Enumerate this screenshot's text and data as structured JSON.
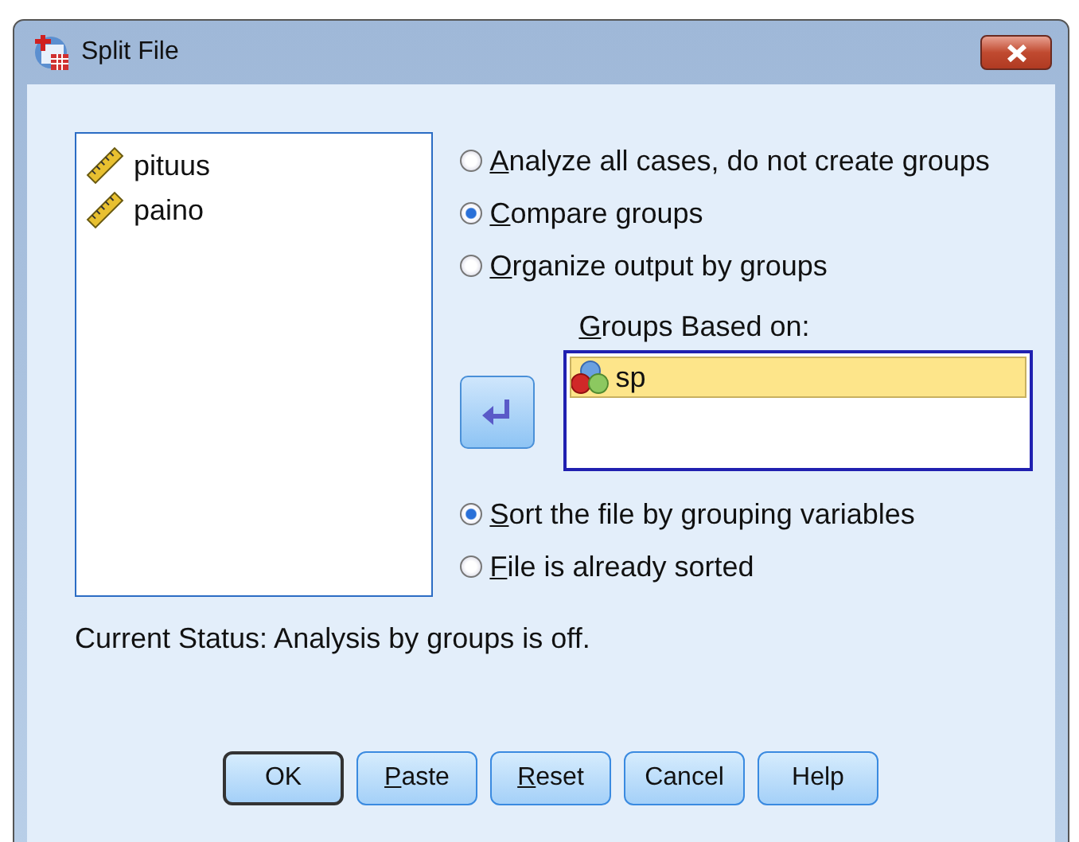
{
  "window": {
    "title": "Split File"
  },
  "variables": [
    {
      "name": "pituus"
    },
    {
      "name": "paino"
    }
  ],
  "grouping_options": [
    {
      "label": "Analyze all cases, do not create groups",
      "selected": false,
      "underline_first": true
    },
    {
      "label": "Compare groups",
      "selected": true,
      "underline_first": true
    },
    {
      "label": "Organize output by groups",
      "selected": false,
      "underline_first": true
    }
  ],
  "groups_based_on": {
    "label": "Groups Based on:",
    "underline_first": true,
    "items": [
      {
        "name": "sp",
        "selected": true
      }
    ]
  },
  "sort_options": [
    {
      "label": "Sort the file by grouping variables",
      "selected": true,
      "underline_first": true
    },
    {
      "label": "File is already sorted",
      "selected": false,
      "underline_first": true
    }
  ],
  "status": "Current Status: Analysis by groups is off.",
  "buttons": [
    {
      "label": "OK",
      "default": true,
      "underline_first": false
    },
    {
      "label": "Paste",
      "default": false,
      "underline_first": true
    },
    {
      "label": "Reset",
      "default": false,
      "underline_first": true
    },
    {
      "label": "Cancel",
      "default": false,
      "underline_first": false
    },
    {
      "label": "Help",
      "default": false,
      "underline_first": false
    }
  ]
}
